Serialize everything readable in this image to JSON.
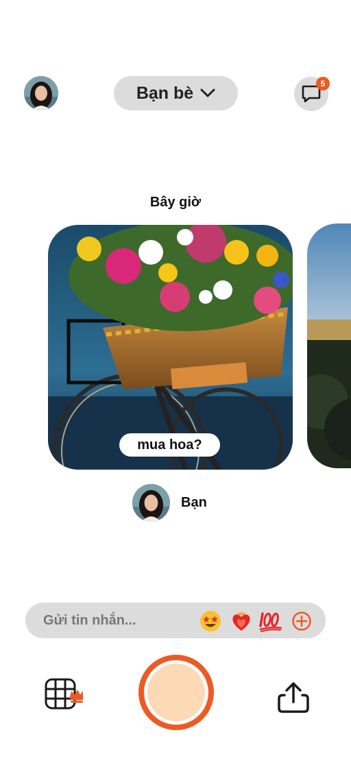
{
  "header": {
    "audience_label": "Bạn bè",
    "chat_badge_count": "5"
  },
  "feed": {
    "time_label": "Bây giờ",
    "caption": "mua hoa?",
    "poster_name": "Bạn"
  },
  "composer": {
    "placeholder": "Gửi tin nhắn...",
    "reactions": [
      "star-struck-emoji",
      "heart-on-fire-emoji",
      "hundred-points-emoji",
      "add-reaction-icon"
    ]
  },
  "colors": {
    "accent": "#ee5a24",
    "pill_bg": "#dcdcdc",
    "shutter_core": "#fdd9b5"
  }
}
